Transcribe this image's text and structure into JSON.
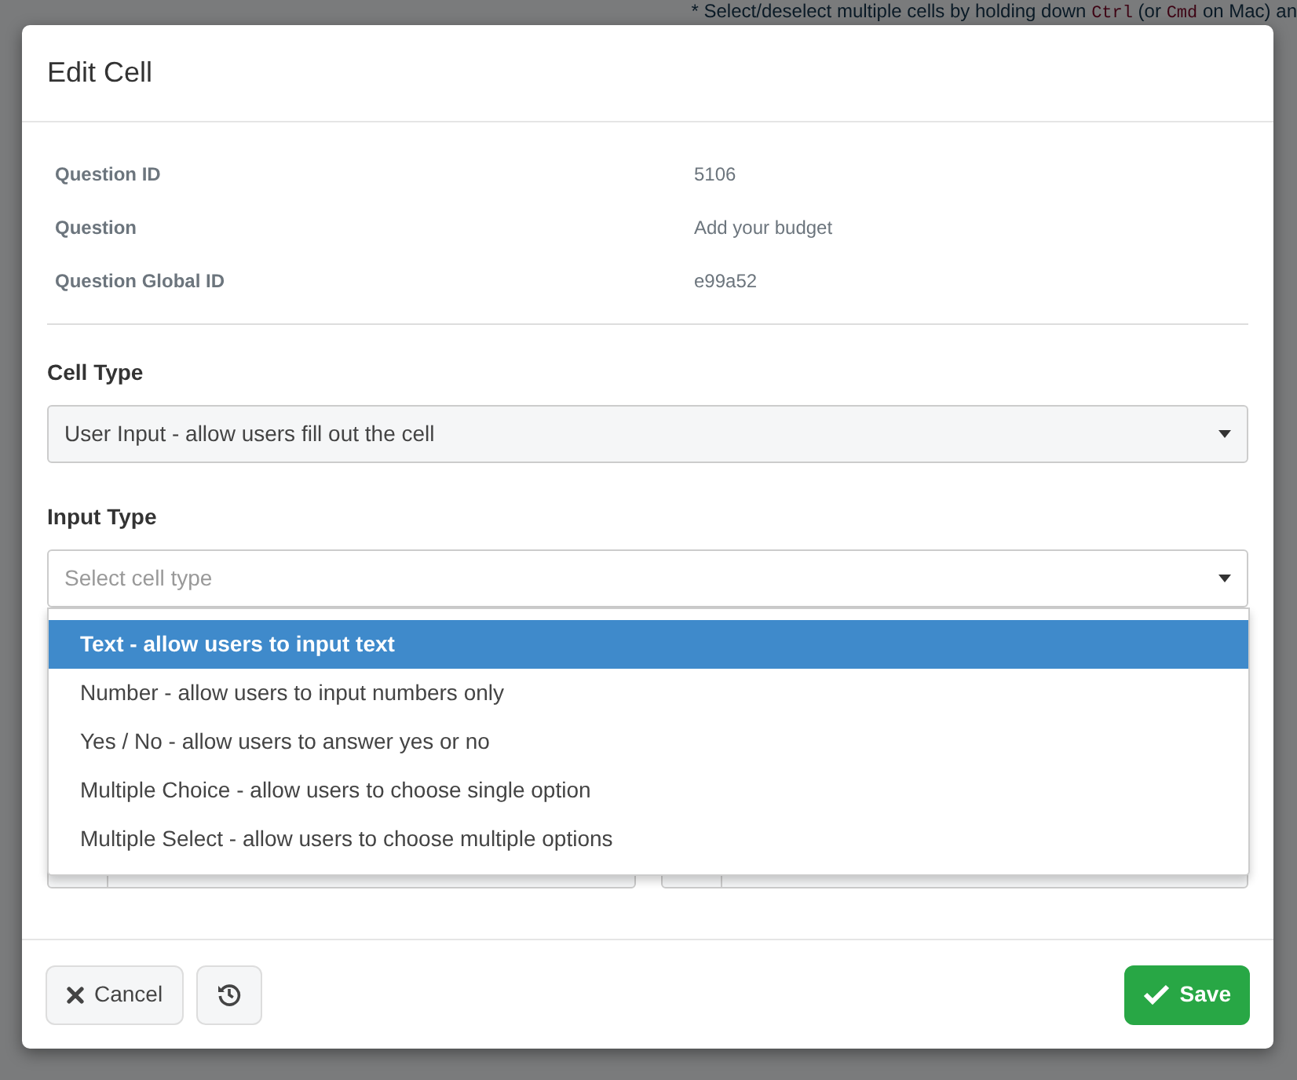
{
  "background_note": [
    {
      "kind": "text",
      "text": "* Select/deselect multiple cells by holding down "
    },
    {
      "kind": "code",
      "text": "Ctrl"
    },
    {
      "kind": "text",
      "text": " (or "
    },
    {
      "kind": "code",
      "text": "Cmd"
    },
    {
      "kind": "text",
      "text": " on Mac) an"
    }
  ],
  "modal": {
    "title": "Edit Cell",
    "details": [
      {
        "label": "Question ID",
        "value": "5106"
      },
      {
        "label": "Question",
        "value": "Add your budget"
      },
      {
        "label": "Question Global ID",
        "value": "e99a52"
      }
    ],
    "cell_type": {
      "label": "Cell Type",
      "value": "User Input - allow users fill out the cell"
    },
    "input_type": {
      "label": "Input Type",
      "placeholder": "Select cell type",
      "expanded": true,
      "options": [
        {
          "label": "Text - allow users to input text",
          "selected": true
        },
        {
          "label": "Number - allow users to input numbers only",
          "selected": false
        },
        {
          "label": "Yes / No - allow users to answer yes or no",
          "selected": false
        },
        {
          "label": "Multiple Choice - allow users to choose single option",
          "selected": false
        },
        {
          "label": "Multiple Select - allow users to choose multiple options",
          "selected": false
        }
      ]
    },
    "footer": {
      "cancel": "Cancel",
      "save": "Save"
    }
  }
}
